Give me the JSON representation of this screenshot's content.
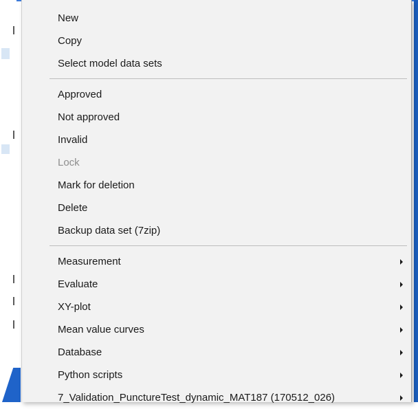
{
  "menu": {
    "groups": [
      {
        "items": [
          {
            "label": "New",
            "enabled": true,
            "submenu": false
          },
          {
            "label": "Copy",
            "enabled": true,
            "submenu": false
          },
          {
            "label": "Select model data sets",
            "enabled": true,
            "submenu": false
          }
        ]
      },
      {
        "items": [
          {
            "label": "Approved",
            "enabled": true,
            "submenu": false
          },
          {
            "label": "Not approved",
            "enabled": true,
            "submenu": false
          },
          {
            "label": "Invalid",
            "enabled": true,
            "submenu": false
          },
          {
            "label": "Lock",
            "enabled": false,
            "submenu": false
          },
          {
            "label": "Mark for deletion",
            "enabled": true,
            "submenu": false
          },
          {
            "label": "Delete",
            "enabled": true,
            "submenu": false
          },
          {
            "label": "Backup data set (7zip)",
            "enabled": true,
            "submenu": false
          }
        ]
      },
      {
        "items": [
          {
            "label": "Measurement",
            "enabled": true,
            "submenu": true
          },
          {
            "label": "Evaluate",
            "enabled": true,
            "submenu": true
          },
          {
            "label": "XY-plot",
            "enabled": true,
            "submenu": true
          },
          {
            "label": "Mean value curves",
            "enabled": true,
            "submenu": true
          },
          {
            "label": "Database",
            "enabled": true,
            "submenu": true
          },
          {
            "label": "Python scripts",
            "enabled": true,
            "submenu": true
          },
          {
            "label": "7_Validation_PunctureTest_dynamic_MAT187 (170512_026)",
            "enabled": true,
            "submenu": true
          }
        ]
      }
    ]
  },
  "colors": {
    "menu_bg": "#f2f2f2",
    "text": "#1a1a1a",
    "disabled_text": "#8e8e8e",
    "separator": "#bdbdbd",
    "accent": "#1a5dbd"
  }
}
